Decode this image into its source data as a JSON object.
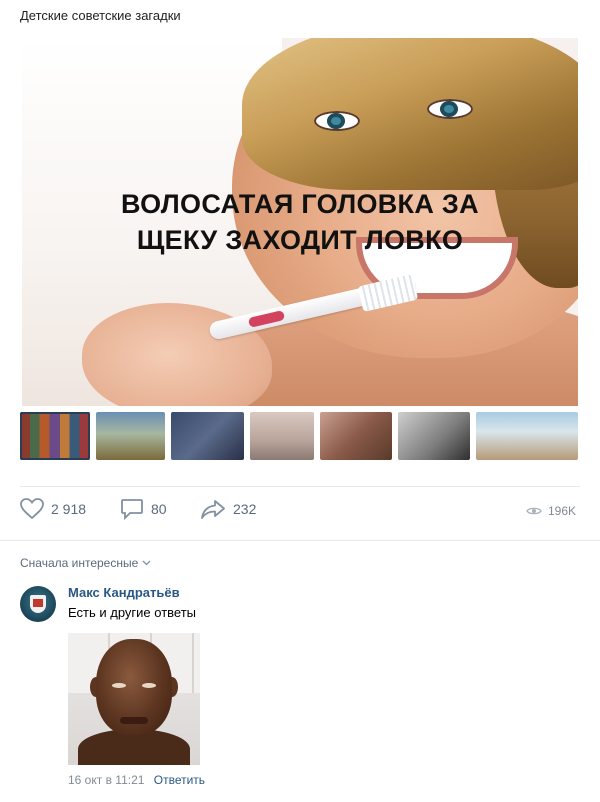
{
  "post": {
    "text": "Детские советские загадки",
    "image_caption_line1": "ВОЛОСАТАЯ ГОЛОВКА ЗА",
    "image_caption_line2": "ЩЕКУ ЗАХОДИТ ЛОВКО"
  },
  "actions": {
    "likes": "2 918",
    "comments": "80",
    "shares": "232",
    "views": "196K"
  },
  "comments_section": {
    "sort_label": "Сначала интересные",
    "comment": {
      "author": "Макс Кандратьёв",
      "text": "Есть и другие ответы",
      "date": "16 окт в 11:21",
      "reply_label": "Ответить"
    }
  },
  "colors": {
    "link": "#2a5885",
    "muted": "#828a94",
    "action": "#5a6a7e"
  }
}
